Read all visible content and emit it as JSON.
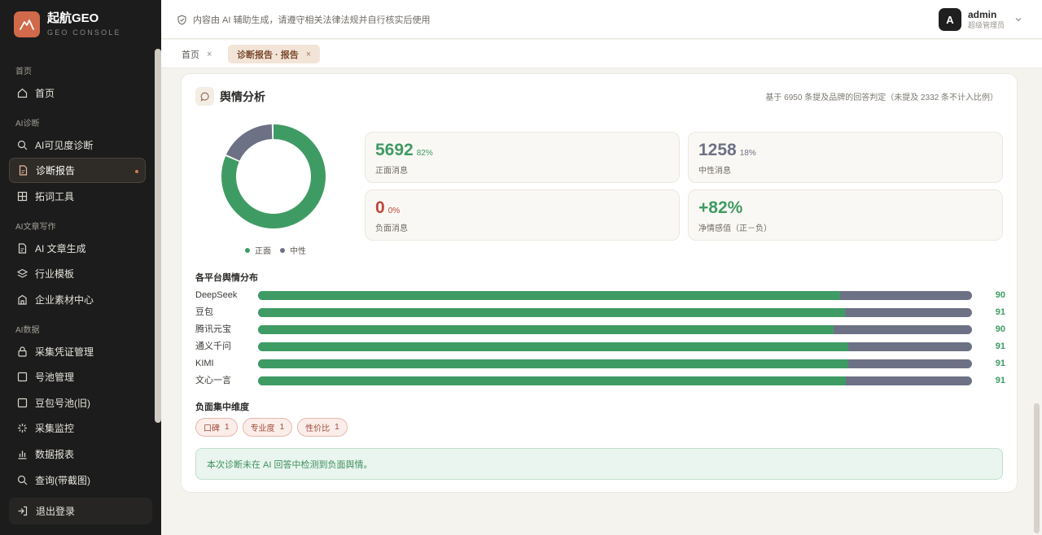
{
  "brand": {
    "name": "起航GEO",
    "subtitle": "GEO CONSOLE"
  },
  "sidebar": {
    "sections": [
      {
        "label": "首页"
      },
      {
        "label": "AI诊断"
      },
      {
        "label": "AI文章写作"
      },
      {
        "label": "AI数据"
      }
    ],
    "items": [
      {
        "label": "首页",
        "icon": "home-icon"
      },
      {
        "label": "AI可见度诊断",
        "icon": "search-icon"
      },
      {
        "label": "诊断报告",
        "icon": "report-icon",
        "active": true
      },
      {
        "label": "拓词工具",
        "icon": "grid-icon"
      },
      {
        "label": "AI 文章生成",
        "icon": "document-icon"
      },
      {
        "label": "行业模板",
        "icon": "layers-icon"
      },
      {
        "label": "企业素材中心",
        "icon": "building-icon"
      },
      {
        "label": "采集凭证管理",
        "icon": "lock-icon"
      },
      {
        "label": "号池管理",
        "icon": "square-icon"
      },
      {
        "label": "豆包号池(旧)",
        "icon": "square-icon"
      },
      {
        "label": "采集监控",
        "icon": "activity-icon"
      },
      {
        "label": "数据报表",
        "icon": "bar-chart-icon"
      },
      {
        "label": "查询(带截图)",
        "icon": "search-icon"
      }
    ],
    "logout_label": "退出登录"
  },
  "header": {
    "notice": "内容由 AI 辅助生成，请遵守相关法律法规并自行核实后使用",
    "user": {
      "avatar_letter": "A",
      "name": "admin",
      "role": "超级管理员"
    }
  },
  "tabs": [
    {
      "label": "首页",
      "close": "×"
    },
    {
      "label": "诊断报告 · 报告",
      "close": "×",
      "active": true
    }
  ],
  "card": {
    "title": "舆情分析",
    "note": "基于 6950 条提及品牌的回答判定（未提及 2332 条不计入比例）",
    "donut": {
      "positive": 5692,
      "neutral": 1258,
      "negative": 0
    },
    "legend": {
      "positive": "正面",
      "neutral": "中性"
    },
    "stats": {
      "positive": {
        "value": "5692",
        "pct": "82%",
        "label": "正面消息"
      },
      "neutral": {
        "value": "1258",
        "pct": "18%",
        "label": "中性消息"
      },
      "negative": {
        "value": "0",
        "pct": "0%",
        "label": "负面消息"
      },
      "net": {
        "value": "+82%",
        "label": "净情感值（正－负）"
      }
    },
    "platforms_title": "各平台舆情分布",
    "platforms": [
      {
        "name": "DeepSeek",
        "positive_fraction": 0.815,
        "value": "90"
      },
      {
        "name": "豆包",
        "positive_fraction": 0.822,
        "value": "91"
      },
      {
        "name": "腾讯元宝",
        "positive_fraction": 0.806,
        "value": "90"
      },
      {
        "name": "通义千问",
        "positive_fraction": 0.827,
        "value": "91"
      },
      {
        "name": "KIMI",
        "positive_fraction": 0.827,
        "value": "91"
      },
      {
        "name": "文心一言",
        "positive_fraction": 0.823,
        "value": "91"
      }
    ],
    "negative_title": "负面集中维度",
    "negative_tags": [
      {
        "label": "口碑",
        "count": "1"
      },
      {
        "label": "专业度",
        "count": "1"
      },
      {
        "label": "性价比",
        "count": "1"
      }
    ],
    "result_message": "本次诊断未在 AI 回答中检测到负面舆情。"
  },
  "colors": {
    "positive": "#3f9b64",
    "neutral": "#6d7185",
    "negative": "#c0473a",
    "accent": "#d06a4a"
  }
}
